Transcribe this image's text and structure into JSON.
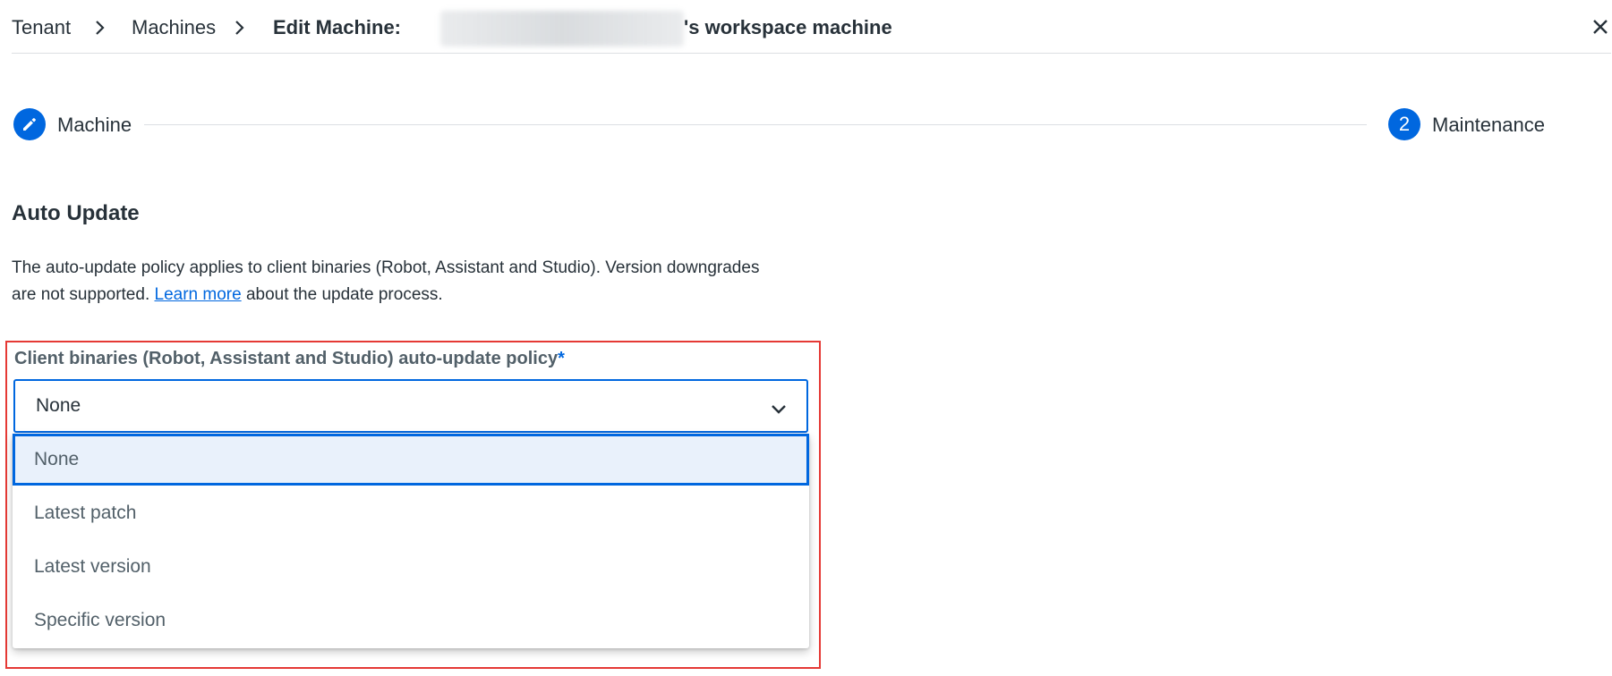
{
  "breadcrumb": {
    "items": [
      "Tenant",
      "Machines"
    ],
    "current_prefix": "Edit Machine:",
    "current_suffix": "'s workspace machine"
  },
  "stepper": {
    "steps": [
      {
        "label": "Machine",
        "icon": "pencil-icon",
        "state": "completed"
      },
      {
        "label": "Maintenance",
        "number": "2",
        "state": "active"
      }
    ]
  },
  "section": {
    "title": "Auto Update",
    "description_before": "The auto-update policy applies to client binaries (Robot, Assistant and Studio). Version downgrades are not supported. ",
    "link_text": "Learn more",
    "description_after": " about the update process."
  },
  "policy_field": {
    "label": "Client binaries (Robot, Assistant and Studio) auto-update policy",
    "required_mark": "*",
    "value": "None",
    "options": [
      "None",
      "Latest patch",
      "Latest version",
      "Specific version"
    ]
  },
  "colors": {
    "accent": "#0067df",
    "highlight": "#e53935",
    "selected_bg": "#e9f1fb",
    "text": "#273139",
    "muted": "#526069"
  }
}
